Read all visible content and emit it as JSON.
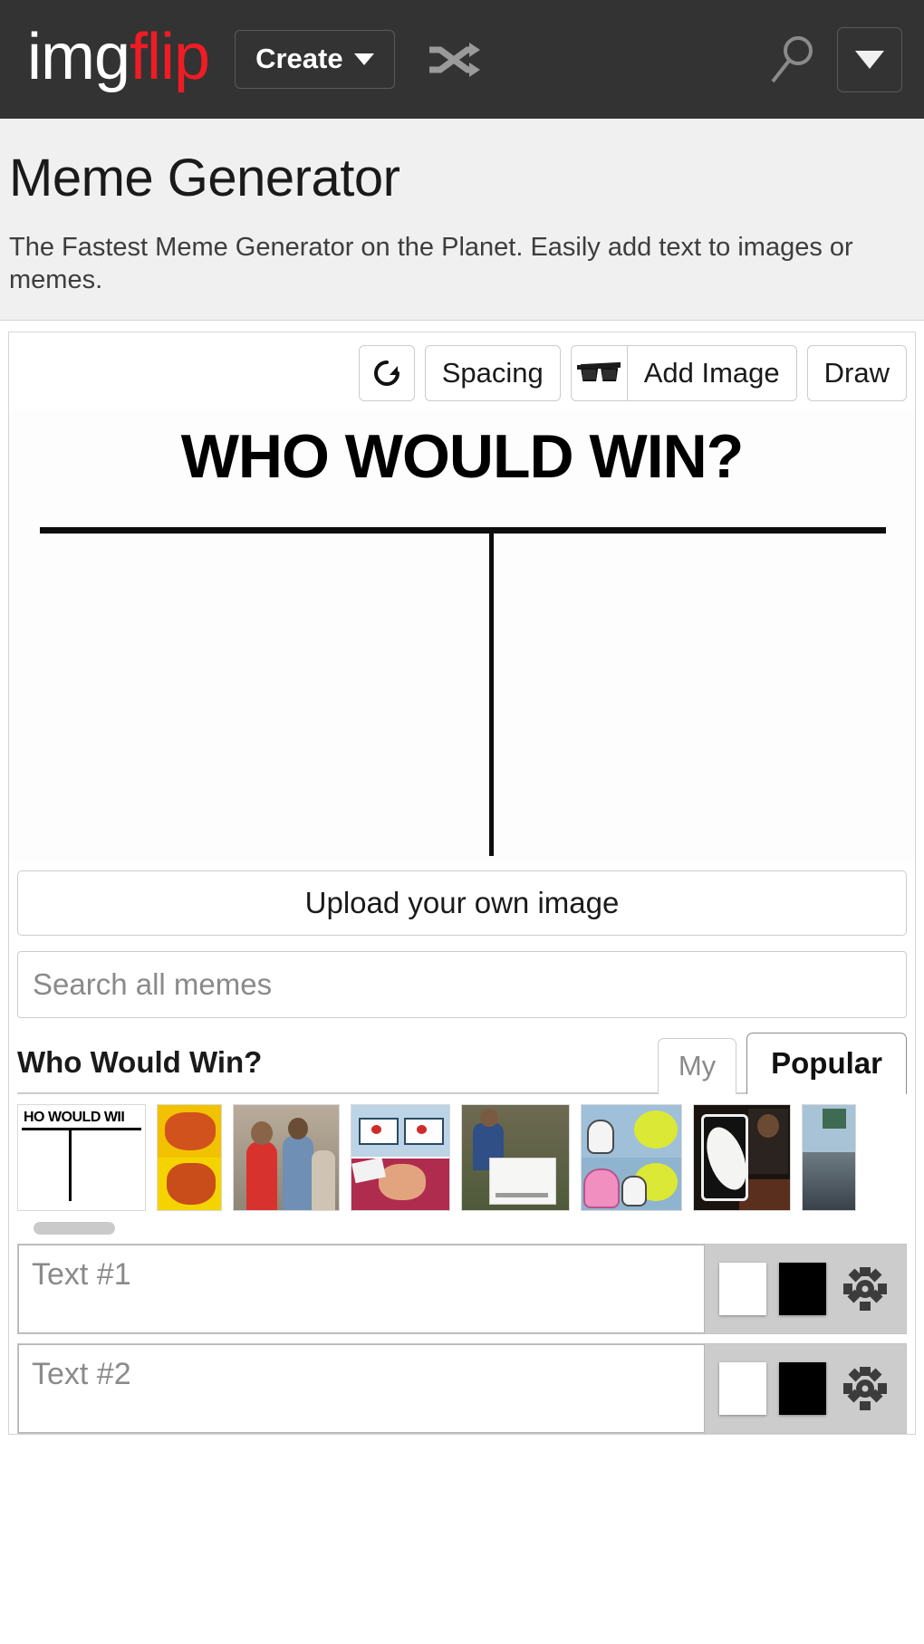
{
  "header": {
    "logo_img": "img",
    "logo_flip": "flip",
    "create_label": "Create",
    "shuffle_icon": "shuffle-icon",
    "search_icon": "search-icon",
    "dropdown_icon": "chevron-down-icon"
  },
  "page": {
    "title": "Meme Generator",
    "subtitle": "The Fastest Meme Generator on the Planet. Easily add text to images or memes."
  },
  "toolbar": {
    "reset_icon": "rotate-icon",
    "spacing_label": "Spacing",
    "sunglasses_icon": "sunglasses-icon",
    "add_image_label": "Add Image",
    "draw_label": "Draw"
  },
  "canvas": {
    "top_text": "WHO WOULD WIN?",
    "divider_position_percent": 53
  },
  "actions": {
    "upload_label": "Upload your own image",
    "search_placeholder": "Search all memes"
  },
  "section": {
    "title": "Who Would Win?",
    "tabs": [
      {
        "label": "My",
        "active": false
      },
      {
        "label": "Popular",
        "active": true
      }
    ]
  },
  "thumbnails": [
    {
      "name": "who-would-win",
      "label": "HO WOULD WII"
    },
    {
      "name": "drake-hotline-bling"
    },
    {
      "name": "distracted-boyfriend"
    },
    {
      "name": "anime-butterfly"
    },
    {
      "name": "change-my-mind"
    },
    {
      "name": "monkey-puppet-balloon"
    },
    {
      "name": "uno-draw-25-cards"
    },
    {
      "name": "partial-thumbnail"
    }
  ],
  "text_rows": [
    {
      "placeholder": "Text #1",
      "fill_color": "#ffffff",
      "outline_color": "#000000",
      "settings_icon": "gear-icon"
    },
    {
      "placeholder": "Text #2",
      "fill_color": "#ffffff",
      "outline_color": "#000000",
      "settings_icon": "gear-icon"
    }
  ],
  "colors": {
    "header_bg": "#333333",
    "logo_red": "#ee1c24",
    "page_bg": "#f0f0f0",
    "border": "#cccccc"
  }
}
